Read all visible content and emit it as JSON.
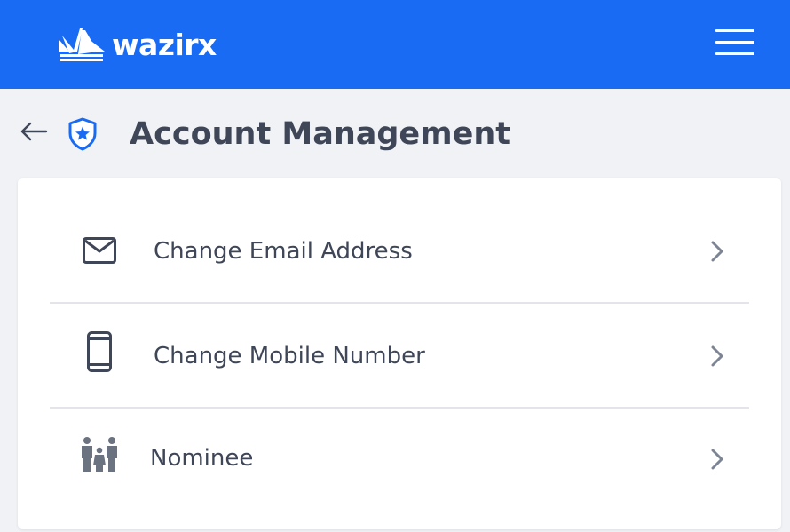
{
  "brand": {
    "name": "wazirx",
    "logo_icon": "wazirx-logo-icon",
    "color": "#1a6bf3"
  },
  "header": {
    "menu_icon": "hamburger-menu-icon"
  },
  "page": {
    "back_icon": "arrow-left-icon",
    "title_icon": "shield-star-icon",
    "title": "Account Management"
  },
  "menu_items": [
    {
      "label": "Change Email Address",
      "icon": "mail-icon",
      "chevron": "chevron-right-icon"
    },
    {
      "label": "Change Mobile Number",
      "icon": "mobile-phone-icon",
      "chevron": "chevron-right-icon"
    },
    {
      "label": "Nominee",
      "icon": "family-icon",
      "chevron": "chevron-right-icon"
    }
  ],
  "colors": {
    "text": "#3e4657",
    "icon": "#3e4657",
    "chevron": "#7d8594",
    "background": "#f0f2f6",
    "card": "#ffffff",
    "accent": "#1a6bf3"
  }
}
